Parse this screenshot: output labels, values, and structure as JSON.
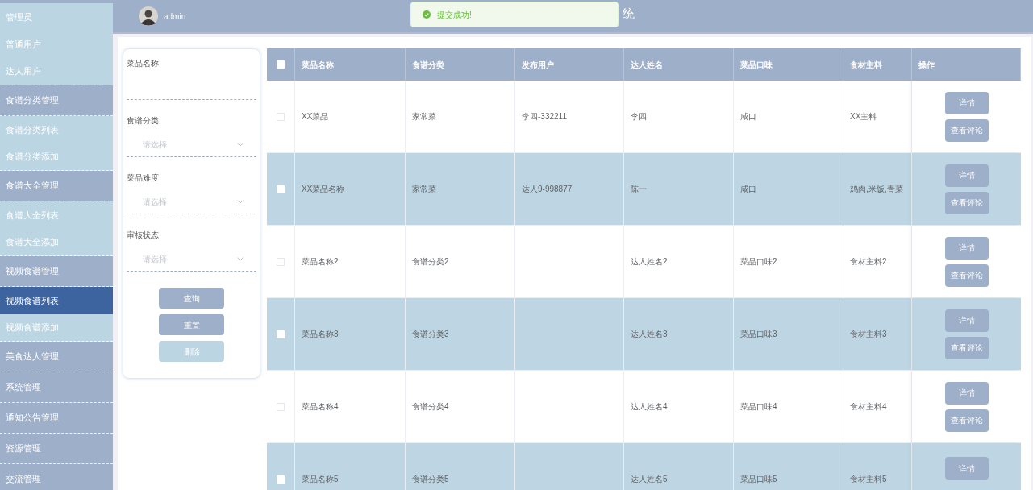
{
  "sidebar": {
    "items": [
      {
        "label": "管理员",
        "kind": "sub",
        "selected": false
      },
      {
        "label": "普通用户",
        "kind": "sub",
        "selected": false
      },
      {
        "label": "达人用户",
        "kind": "sub",
        "selected": false
      },
      {
        "label": "食谱分类管理",
        "kind": "header",
        "selected": false
      },
      {
        "label": "食谱分类列表",
        "kind": "sub",
        "selected": false
      },
      {
        "label": "食谱分类添加",
        "kind": "sub",
        "selected": false
      },
      {
        "label": "食谱大全管理",
        "kind": "header",
        "selected": false
      },
      {
        "label": "食谱大全列表",
        "kind": "sub",
        "selected": false
      },
      {
        "label": "食谱大全添加",
        "kind": "sub",
        "selected": false
      },
      {
        "label": "视频食谱管理",
        "kind": "header",
        "selected": false
      },
      {
        "label": "视频食谱列表",
        "kind": "sub",
        "selected": true
      },
      {
        "label": "视频食谱添加",
        "kind": "sub",
        "selected": false
      },
      {
        "label": "美食达人管理",
        "kind": "header",
        "selected": false
      },
      {
        "label": "系统管理",
        "kind": "header",
        "selected": false
      },
      {
        "label": "通知公告管理",
        "kind": "header",
        "selected": false
      },
      {
        "label": "资源管理",
        "kind": "header",
        "selected": false
      },
      {
        "label": "交流管理",
        "kind": "header",
        "selected": false
      }
    ]
  },
  "header": {
    "username": "admin",
    "title": "统"
  },
  "toast": {
    "message": "提交成功!"
  },
  "filters": {
    "fields": [
      {
        "label": "菜品名称",
        "kind": "text"
      },
      {
        "label": "食谱分类",
        "kind": "select",
        "placeholder": "请选择"
      },
      {
        "label": "菜品难度",
        "kind": "select",
        "placeholder": "请选择"
      },
      {
        "label": "审核状态",
        "kind": "select",
        "placeholder": "请选择"
      }
    ],
    "buttons": [
      {
        "label": "查询",
        "disabled": false
      },
      {
        "label": "重置",
        "disabled": false
      },
      {
        "label": "删除",
        "disabled": true
      }
    ]
  },
  "table": {
    "select_all": {
      "checked": false
    },
    "columns": [
      "菜品名称",
      "食谱分类",
      "发布用户",
      "达人姓名",
      "菜品口味",
      "食材主料",
      "操作"
    ],
    "rows": [
      {
        "checked": false,
        "cells": [
          "XX菜品",
          "家常菜",
          "李四-332211",
          "李四",
          "咸口",
          "XX主料"
        ],
        "actions": [
          "详情",
          "查看评论"
        ]
      },
      {
        "checked": false,
        "cells": [
          "XX菜品名称",
          "家常菜",
          "达人9-998877",
          "陈一",
          "咸口",
          "鸡肉,米饭,青菜"
        ],
        "actions": [
          "详情",
          "查看评论"
        ]
      },
      {
        "checked": false,
        "cells": [
          "菜品名称2",
          "食谱分类2",
          "",
          "达人姓名2",
          "菜品口味2",
          "食材主料2"
        ],
        "actions": [
          "详情",
          "查看评论"
        ]
      },
      {
        "checked": false,
        "cells": [
          "菜品名称3",
          "食谱分类3",
          "",
          "达人姓名3",
          "菜品口味3",
          "食材主料3"
        ],
        "actions": [
          "详情",
          "查看评论"
        ]
      },
      {
        "checked": false,
        "cells": [
          "菜品名称4",
          "食谱分类4",
          "",
          "达人姓名4",
          "菜品口味4",
          "食材主料4"
        ],
        "actions": [
          "详情",
          "查看评论"
        ]
      },
      {
        "checked": false,
        "cells": [
          "菜品名称5",
          "食谱分类5",
          "",
          "达人姓名5",
          "菜品口味5",
          "食材主料5"
        ],
        "actions": [
          "详情"
        ]
      }
    ]
  }
}
